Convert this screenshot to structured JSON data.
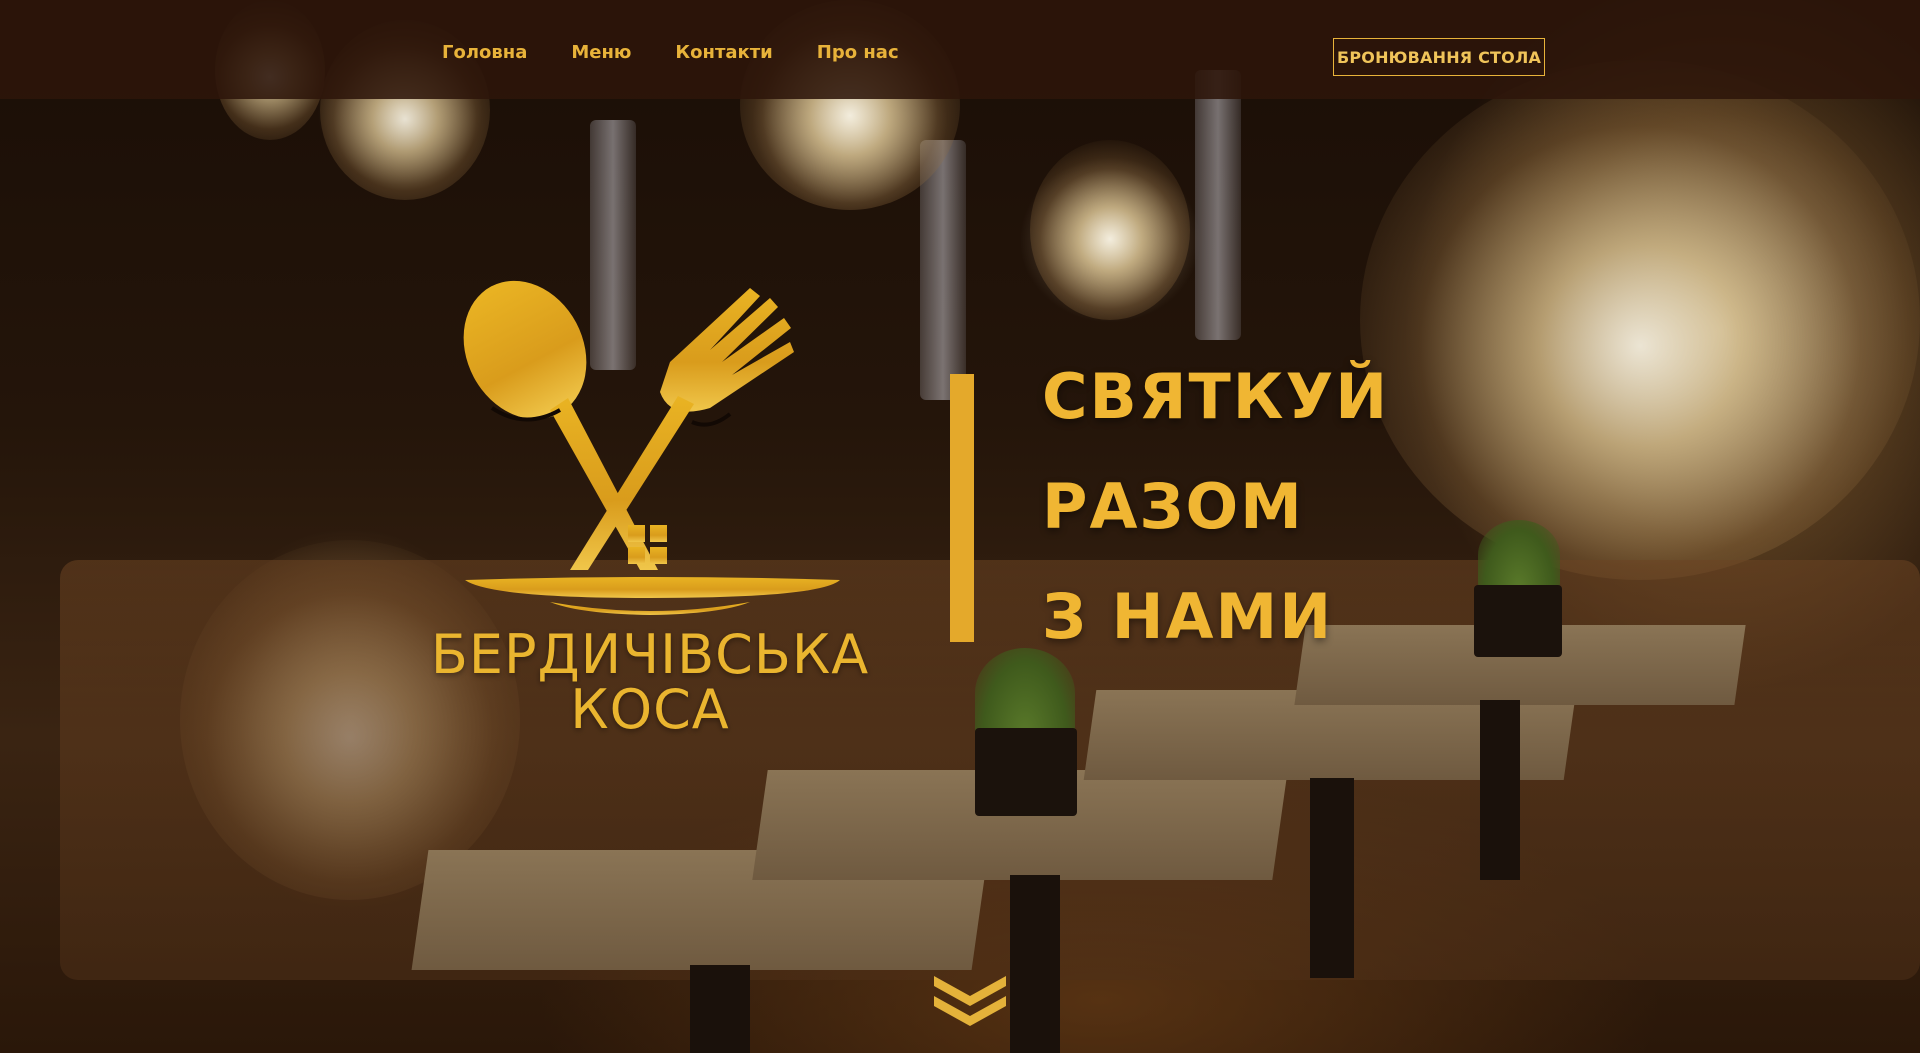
{
  "nav": {
    "items": [
      {
        "label": "Головна"
      },
      {
        "label": "Меню"
      },
      {
        "label": "Контакти"
      },
      {
        "label": "Про нас"
      }
    ],
    "book_label": "БРОНЮВАННЯ СТОЛА"
  },
  "brand": {
    "line1": "БЕРДИЧІВСЬКА",
    "line2": "КОСА",
    "logo_icon": "spoon-fork-house-icon"
  },
  "hero": {
    "slogan": [
      "СВЯТКУЙ",
      "РАЗОМ",
      "З НАМИ"
    ]
  },
  "scroll": {
    "icon": "double-chevron-down-icon"
  },
  "colors": {
    "accent": "#e8b33a",
    "topbar": "#2e160a"
  }
}
